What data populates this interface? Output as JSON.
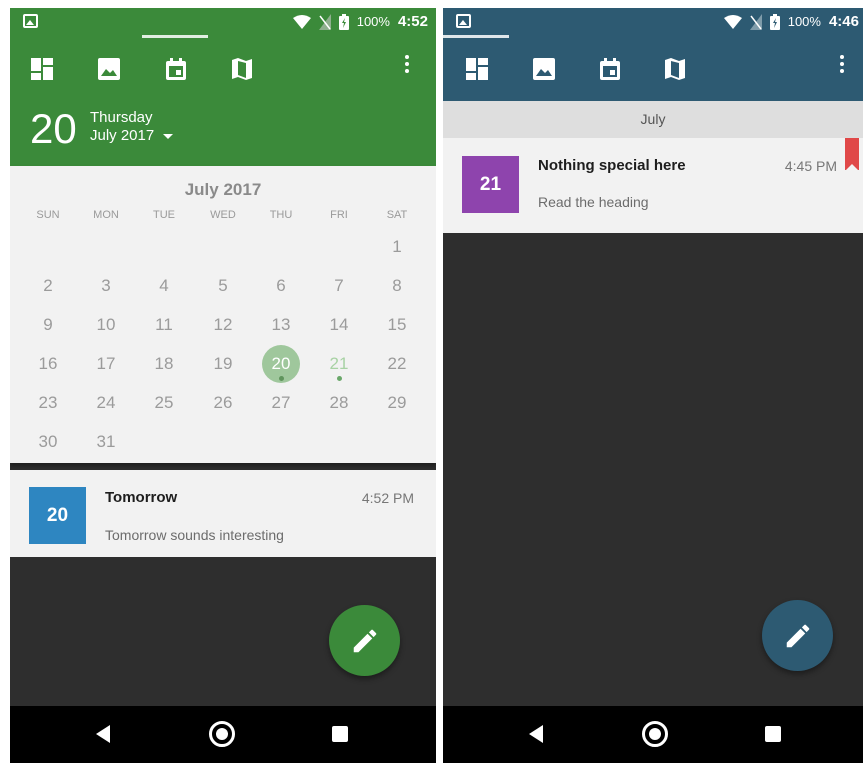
{
  "left_screen": {
    "status": {
      "battery": "100%",
      "time": "4:52"
    },
    "toolbar": {
      "icons": [
        "dashboard-icon",
        "image-icon",
        "calendar-icon",
        "map-icon"
      ],
      "overflow": "overflow-menu-icon"
    },
    "header": {
      "day": "20",
      "weekday": "Thursday",
      "month_year": "July 2017"
    },
    "calendar": {
      "title": "July 2017",
      "weekdays": [
        "SUN",
        "MON",
        "TUE",
        "WED",
        "THU",
        "FRI",
        "SAT"
      ],
      "weeks": [
        [
          "",
          "",
          "",
          "",
          "",
          "",
          "1"
        ],
        [
          "2",
          "3",
          "4",
          "5",
          "6",
          "7",
          "8"
        ],
        [
          "9",
          "10",
          "11",
          "12",
          "13",
          "14",
          "15"
        ],
        [
          "16",
          "17",
          "18",
          "19",
          "20",
          "21",
          "22"
        ],
        [
          "23",
          "24",
          "25",
          "26",
          "27",
          "28",
          "29"
        ],
        [
          "30",
          "31",
          "",
          "",
          "",
          "",
          ""
        ]
      ],
      "selected_day": "20",
      "event_days": [
        "20",
        "21"
      ]
    },
    "event": {
      "badge": "20",
      "title": "Tomorrow",
      "time": "4:52 PM",
      "description": "Tomorrow sounds interesting",
      "badge_color": "#2e86c1"
    },
    "accent": "#3b8a3a"
  },
  "right_screen": {
    "status": {
      "battery": "100%",
      "time": "4:46"
    },
    "toolbar": {
      "icons": [
        "dashboard-icon",
        "image-icon",
        "calendar-icon",
        "map-icon"
      ],
      "overflow": "overflow-menu-icon"
    },
    "month_header": "July",
    "event": {
      "badge": "21",
      "title": "Nothing special here",
      "time": "4:45 PM",
      "description": "Read the heading",
      "badge_color": "#8e44ad"
    },
    "accent": "#2d5a72"
  }
}
